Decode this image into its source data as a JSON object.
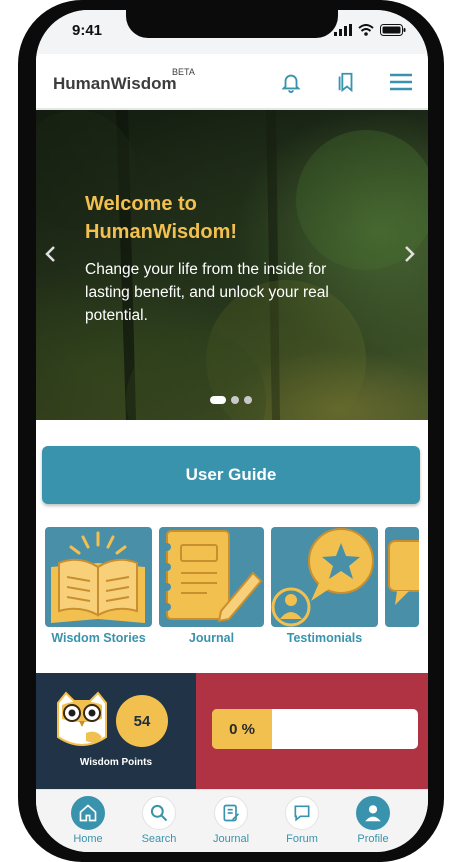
{
  "status_bar": {
    "time": "9:41"
  },
  "header": {
    "brand": "HumanWisdom",
    "beta": "BETA"
  },
  "hero": {
    "title": "Welcome to HumanWisdom!",
    "text": "Change your life from the inside for lasting benefit, and unlock your real potential.",
    "slide_count": 3,
    "active_slide": 1
  },
  "user_guide": {
    "label": "User Guide"
  },
  "tiles": [
    {
      "label": "Wisdom Stories",
      "icon": "open-book-icon"
    },
    {
      "label": "Journal",
      "icon": "notebook-pencil-icon"
    },
    {
      "label": "Testimonials",
      "icon": "star-speech-bubble-icon"
    },
    {
      "label": "",
      "icon": "speech-bubble-icon"
    }
  ],
  "stats": {
    "points_value": "54",
    "points_label": "Wisdom Points",
    "progress_text": "0 %",
    "progress_fraction": 0
  },
  "bottom_nav": [
    {
      "label": "Home",
      "icon": "home-icon",
      "active": true
    },
    {
      "label": "Search",
      "icon": "search-icon",
      "active": false
    },
    {
      "label": "Journal",
      "icon": "journal-icon",
      "active": false
    },
    {
      "label": "Forum",
      "icon": "chat-icon",
      "active": false
    },
    {
      "label": "Profile",
      "icon": "profile-icon",
      "active": true
    }
  ],
  "colors": {
    "accent": "#3a93ad",
    "gold": "#f2c04e",
    "navy": "#213347",
    "crimson": "#b03344"
  }
}
